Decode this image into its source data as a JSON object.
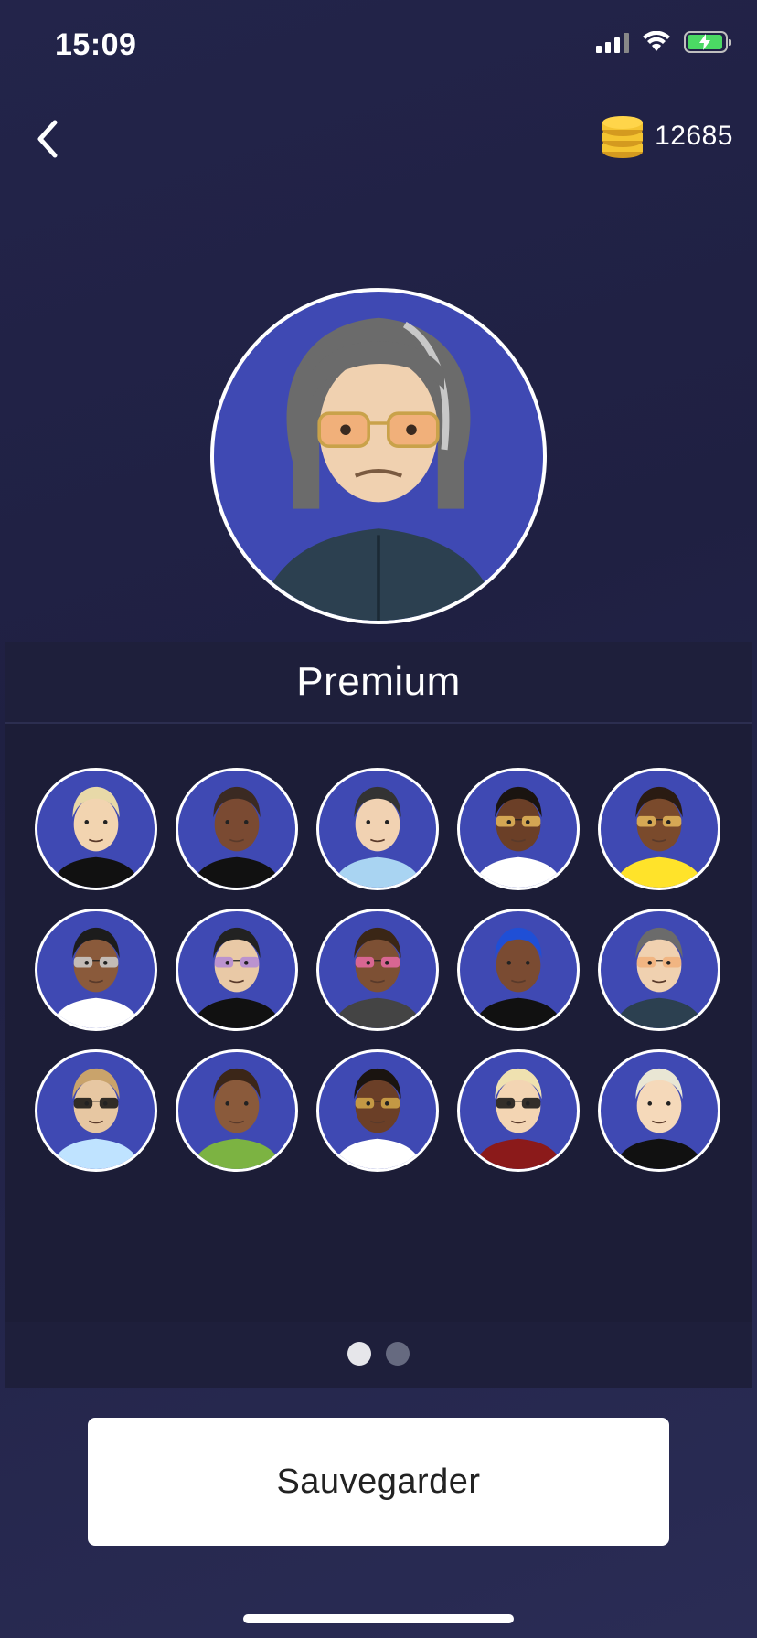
{
  "status_bar": {
    "time": "15:09"
  },
  "header": {
    "coin_count": "12685"
  },
  "panel": {
    "title": "Premium"
  },
  "avatars": [
    {
      "hair": "#e8d9a8",
      "skin": "#f2d4b0",
      "shirt": "#111111",
      "glasses": null
    },
    {
      "hair": "#3b2a22",
      "skin": "#7a4a32",
      "shirt": "#111111",
      "glasses": null
    },
    {
      "hair": "#333333",
      "skin": "#f1d2b2",
      "shirt": "#a9d4f2",
      "glasses": null
    },
    {
      "hair": "#1a1410",
      "skin": "#6b3f27",
      "shirt": "#ffffff",
      "glasses": "#e6b85c"
    },
    {
      "hair": "#2a1b12",
      "skin": "#7a4a2c",
      "shirt": "#ffe32a",
      "glasses": "#e6b85c"
    },
    {
      "hair": "#1c1c1c",
      "skin": "#8a5a3b",
      "shirt": "#ffffff",
      "glasses": "#cccccc"
    },
    {
      "hair": "#222222",
      "skin": "#e9c9a6",
      "shirt": "#111111",
      "glasses": "#b38ad6"
    },
    {
      "hair": "#3a2616",
      "skin": "#7d5034",
      "shirt": "#444444",
      "glasses": "#e86aa3"
    },
    {
      "hair": "#1f4fd6",
      "skin": "#7a4b32",
      "shirt": "#111111",
      "glasses": null
    },
    {
      "hair": "#6b6b6b",
      "skin": "#f0d1b0",
      "shirt": "#2c4050",
      "glasses": "#f1b07a"
    },
    {
      "hair": "#c9a36b",
      "skin": "#e7c7a2",
      "shirt": "#bfe3ff",
      "glasses": "#111111"
    },
    {
      "hair": "#3b2618",
      "skin": "#8a5a3b",
      "shirt": "#7cb342",
      "glasses": null
    },
    {
      "hair": "#1a1410",
      "skin": "#6b3f27",
      "shirt": "#ffffff",
      "glasses": "#d4a84a"
    },
    {
      "hair": "#efe1b0",
      "skin": "#f3d5b3",
      "shirt": "#8b1a1a",
      "glasses": "#111111"
    },
    {
      "hair": "#e9e6d4",
      "skin": "#f5d9ba",
      "shirt": "#111111",
      "glasses": null
    }
  ],
  "pagination": {
    "count": 2,
    "active": 0
  },
  "footer": {
    "save_label": "Sauvegarder"
  },
  "colors": {
    "background": "#23244a",
    "avatar_bg": "#3f49b3",
    "coin": "#f4c431",
    "battery": "#4bd964"
  }
}
